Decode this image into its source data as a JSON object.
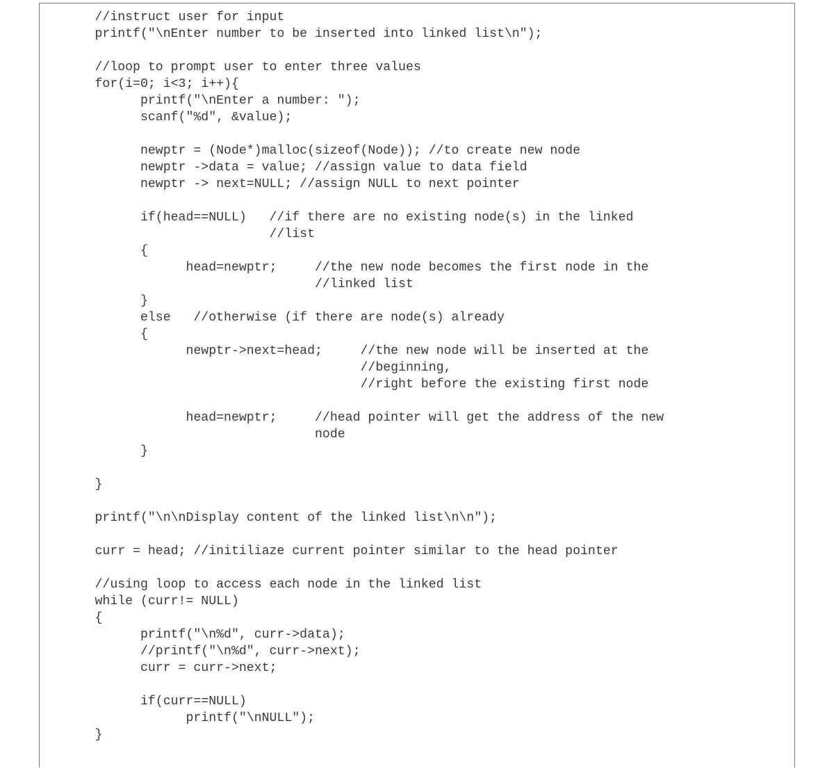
{
  "code": {
    "lines": [
      "      //instruct user for input",
      "      printf(\"\\nEnter number to be inserted into linked list\\n\");",
      "",
      "      //loop to prompt user to enter three values",
      "      for(i=0; i<3; i++){",
      "            printf(\"\\nEnter a number: \");",
      "            scanf(\"%d\", &value);",
      "",
      "            newptr = (Node*)malloc(sizeof(Node)); //to create new node",
      "            newptr ->data = value; //assign value to data field",
      "            newptr -> next=NULL; //assign NULL to next pointer",
      "",
      "            if(head==NULL)   //if there are no existing node(s) in the linked",
      "                             //list",
      "            {",
      "                  head=newptr;     //the new node becomes the first node in the",
      "                                   //linked list",
      "            }",
      "            else   //otherwise (if there are node(s) already",
      "            {",
      "                  newptr->next=head;     //the new node will be inserted at the",
      "                                         //beginning,",
      "                                         //right before the existing first node",
      "",
      "                  head=newptr;     //head pointer will get the address of the new",
      "                                   node",
      "            }",
      "",
      "      }",
      "",
      "      printf(\"\\n\\nDisplay content of the linked list\\n\\n\");",
      "",
      "      curr = head; //initiliaze current pointer similar to the head pointer",
      "",
      "      //using loop to access each node in the linked list",
      "      while (curr!= NULL)",
      "      {",
      "            printf(\"\\n%d\", curr->data);",
      "            //printf(\"\\n%d\", curr->next);",
      "            curr = curr->next;",
      "",
      "            if(curr==NULL)",
      "                  printf(\"\\nNULL\");",
      "      }"
    ]
  }
}
